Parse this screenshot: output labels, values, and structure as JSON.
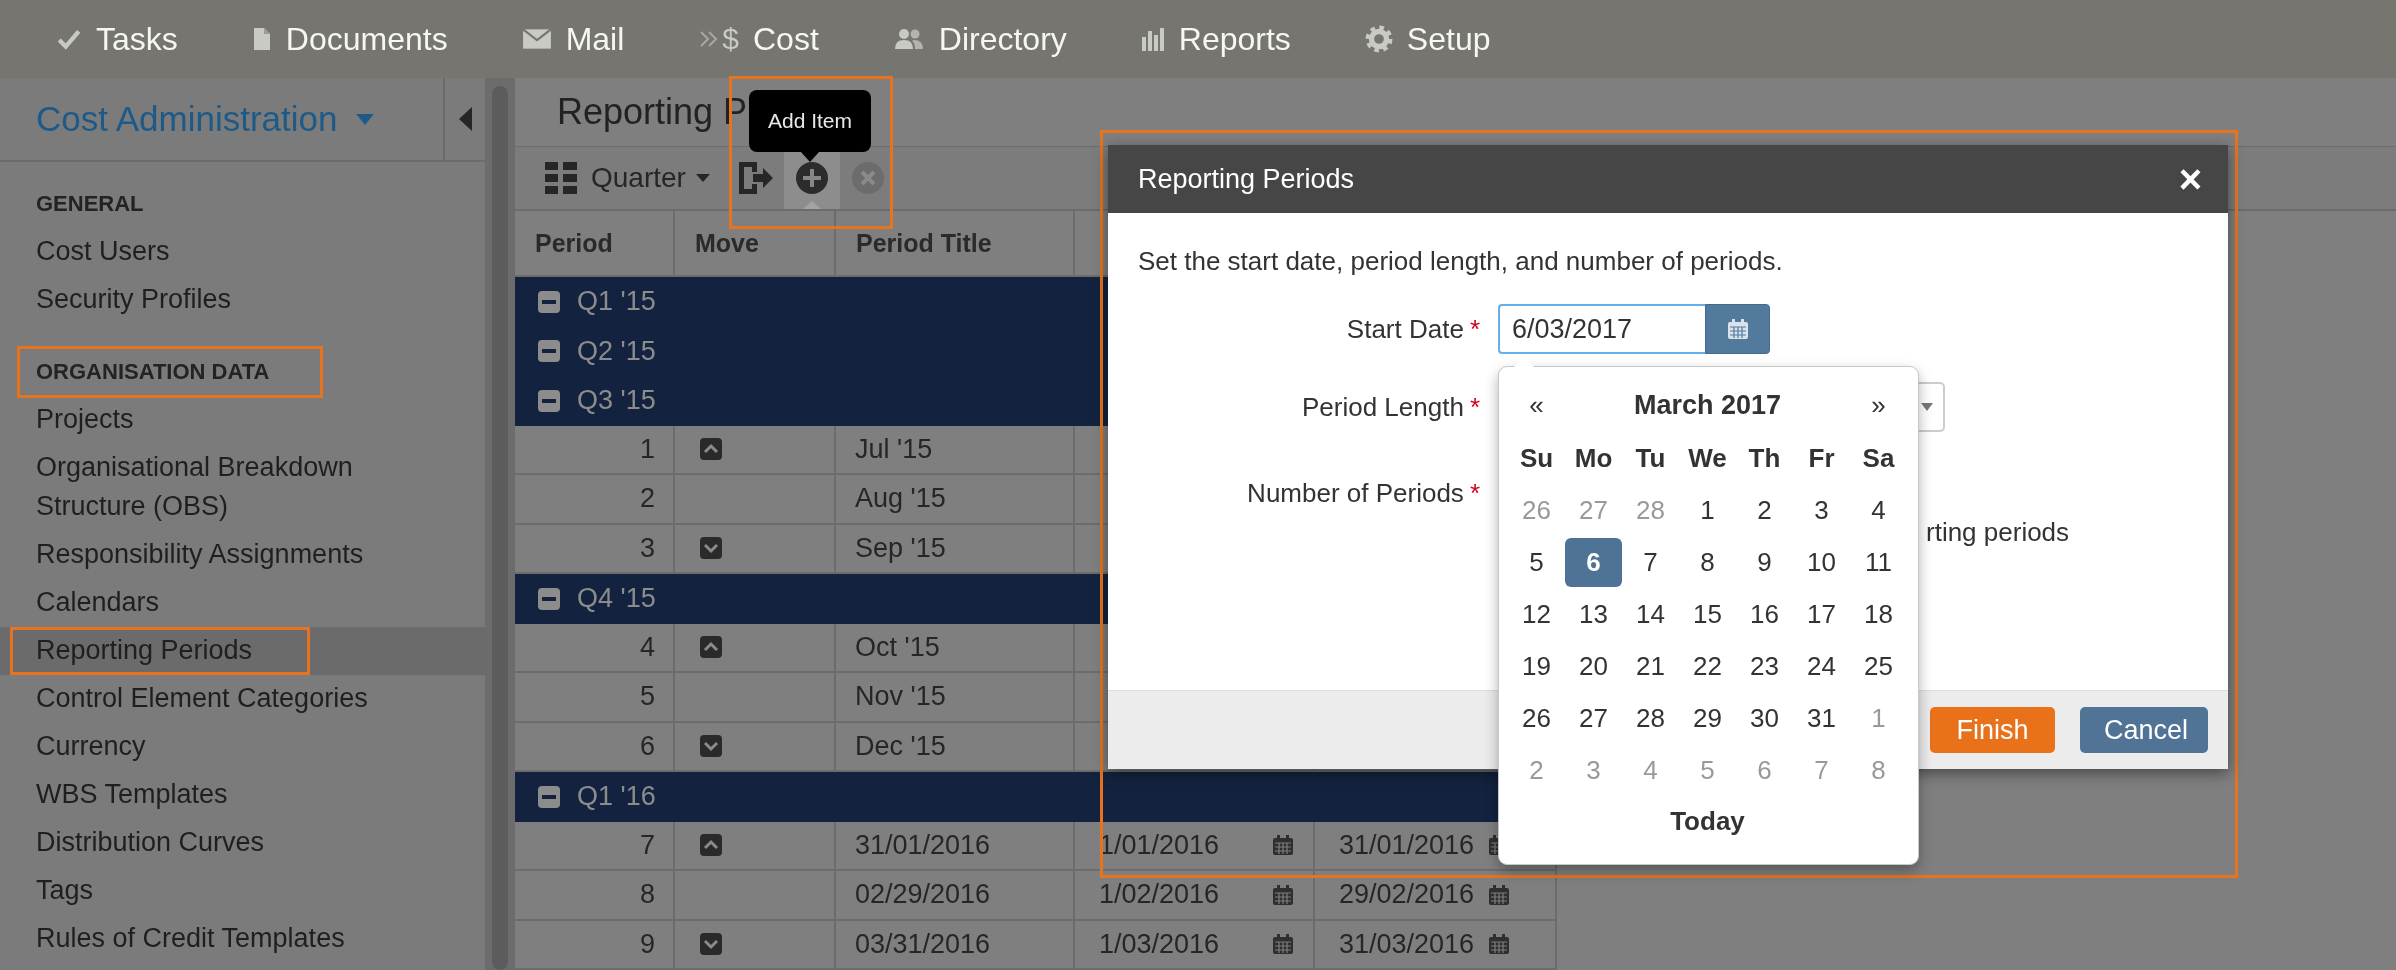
{
  "nav": [
    {
      "kind": "check",
      "label": "Tasks"
    },
    {
      "kind": "document",
      "label": "Documents"
    },
    {
      "kind": "mail",
      "label": "Mail"
    },
    {
      "kind": "cost",
      "icon_text": "$",
      "label": "Cost"
    },
    {
      "kind": "users",
      "label": "Directory"
    },
    {
      "kind": "bars",
      "label": "Reports"
    },
    {
      "kind": "gear",
      "label": "Setup"
    }
  ],
  "sidebar": {
    "title": "Cost Administration",
    "sections": [
      {
        "heading": "GENERAL",
        "framed": false,
        "items": [
          {
            "label": "Cost Users",
            "selected": false,
            "framed": false
          },
          {
            "label": "Security Profiles",
            "selected": false,
            "framed": false
          }
        ]
      },
      {
        "heading": "ORGANISATION DATA",
        "framed": true,
        "items": [
          {
            "label": "Projects",
            "selected": false,
            "framed": false
          },
          {
            "label": "Organisational Breakdown Structure (OBS)",
            "selected": false,
            "framed": false
          },
          {
            "label": "Responsibility Assignments",
            "selected": false,
            "framed": false
          },
          {
            "label": "Calendars",
            "selected": false,
            "framed": false
          },
          {
            "label": "Reporting Periods",
            "selected": true,
            "framed": true
          },
          {
            "label": "Control Element Categories",
            "selected": false,
            "framed": false
          },
          {
            "label": "Currency",
            "selected": false,
            "framed": false
          },
          {
            "label": "WBS Templates",
            "selected": false,
            "framed": false
          },
          {
            "label": "Distribution Curves",
            "selected": false,
            "framed": false
          },
          {
            "label": "Tags",
            "selected": false,
            "framed": false
          },
          {
            "label": "Rules of Credit Templates",
            "selected": false,
            "framed": false
          }
        ]
      }
    ]
  },
  "page_title": "Reporting P",
  "toolbar": {
    "view": "Quarter",
    "framed": true,
    "tooltip": "Add Item",
    "buttons": [
      {
        "kind": "export",
        "hovered": false,
        "disabled": false
      },
      {
        "kind": "add",
        "hovered": true,
        "disabled": false
      },
      {
        "kind": "remove",
        "hovered": false,
        "disabled": true
      }
    ]
  },
  "table": {
    "columns": [
      "Period",
      "Move",
      "Period Title"
    ],
    "rows": [
      {
        "kind": "group",
        "label": "Q1 '15"
      },
      {
        "kind": "group",
        "label": "Q2 '15"
      },
      {
        "kind": "group",
        "label": "Q3 '15"
      },
      {
        "kind": "period",
        "period": "1",
        "can_move_up": true,
        "can_move_down": false,
        "title": "Jul '15"
      },
      {
        "kind": "period",
        "period": "2",
        "can_move_up": false,
        "can_move_down": false,
        "title": "Aug '15"
      },
      {
        "kind": "period",
        "period": "3",
        "can_move_up": false,
        "can_move_down": true,
        "title": "Sep '15"
      },
      {
        "kind": "group",
        "label": "Q4 '15"
      },
      {
        "kind": "period",
        "period": "4",
        "can_move_up": true,
        "can_move_down": false,
        "title": "Oct '15"
      },
      {
        "kind": "period",
        "period": "5",
        "can_move_up": false,
        "can_move_down": false,
        "title": "Nov '15"
      },
      {
        "kind": "period",
        "period": "6",
        "can_move_up": false,
        "can_move_down": true,
        "title": "Dec '15"
      },
      {
        "kind": "group",
        "label": "Q1 '16"
      },
      {
        "kind": "period",
        "period": "7",
        "can_move_up": true,
        "can_move_down": false,
        "title": "31/01/2016",
        "start": "1/01/2016",
        "end": "31/01/2016"
      },
      {
        "kind": "period",
        "period": "8",
        "can_move_up": false,
        "can_move_down": false,
        "title": "02/29/2016",
        "start": "1/02/2016",
        "end": "29/02/2016"
      },
      {
        "kind": "period",
        "period": "9",
        "can_move_up": false,
        "can_move_down": true,
        "title": "03/31/2016",
        "start": "1/03/2016",
        "end": "31/03/2016"
      }
    ]
  },
  "dialog": {
    "title": "Reporting Periods",
    "close": "×",
    "framed": true,
    "intro": "Set the start date, period length, and number of periods.",
    "fields": [
      {
        "label": "Start Date",
        "mark": "*",
        "kind": "date",
        "value": "6/03/2017"
      },
      {
        "label": "Period Length",
        "mark": "*",
        "kind": "select"
      },
      {
        "label": "Number of Periods",
        "mark": "*"
      }
    ],
    "option_text": "rting periods",
    "buttons": [
      {
        "label": "Finish",
        "kind": "primary"
      },
      {
        "label": "Cancel",
        "kind": "secondary"
      }
    ]
  },
  "datepicker": {
    "prev": "«",
    "month": "March 2017",
    "next": "»",
    "weekdays": [
      "Su",
      "Mo",
      "Tu",
      "We",
      "Th",
      "Fr",
      "Sa"
    ],
    "today": "Today",
    "weeks": [
      [
        {
          "day": "26",
          "muted": true,
          "selected": false
        },
        {
          "day": "27",
          "muted": true,
          "selected": false
        },
        {
          "day": "28",
          "muted": true,
          "selected": false
        },
        {
          "day": "1",
          "muted": false,
          "selected": false
        },
        {
          "day": "2",
          "muted": false,
          "selected": false
        },
        {
          "day": "3",
          "muted": false,
          "selected": false
        },
        {
          "day": "4",
          "muted": false,
          "selected": false
        }
      ],
      [
        {
          "day": "5",
          "muted": false,
          "selected": false
        },
        {
          "day": "6",
          "muted": false,
          "selected": true
        },
        {
          "day": "7",
          "muted": false,
          "selected": false
        },
        {
          "day": "8",
          "muted": false,
          "selected": false
        },
        {
          "day": "9",
          "muted": false,
          "selected": false
        },
        {
          "day": "10",
          "muted": false,
          "selected": false
        },
        {
          "day": "11",
          "muted": false,
          "selected": false
        }
      ],
      [
        {
          "day": "12",
          "muted": false,
          "selected": false
        },
        {
          "day": "13",
          "muted": false,
          "selected": false
        },
        {
          "day": "14",
          "muted": false,
          "selected": false
        },
        {
          "day": "15",
          "muted": false,
          "selected": false
        },
        {
          "day": "16",
          "muted": false,
          "selected": false
        },
        {
          "day": "17",
          "muted": false,
          "selected": false
        },
        {
          "day": "18",
          "muted": false,
          "selected": false
        }
      ],
      [
        {
          "day": "19",
          "muted": false,
          "selected": false
        },
        {
          "day": "20",
          "muted": false,
          "selected": false
        },
        {
          "day": "21",
          "muted": false,
          "selected": false
        },
        {
          "day": "22",
          "muted": false,
          "selected": false
        },
        {
          "day": "23",
          "muted": false,
          "selected": false
        },
        {
          "day": "24",
          "muted": false,
          "selected": false
        },
        {
          "day": "25",
          "muted": false,
          "selected": false
        }
      ],
      [
        {
          "day": "26",
          "muted": false,
          "selected": false
        },
        {
          "day": "27",
          "muted": false,
          "selected": false
        },
        {
          "day": "28",
          "muted": false,
          "selected": false
        },
        {
          "day": "29",
          "muted": false,
          "selected": false
        },
        {
          "day": "30",
          "muted": false,
          "selected": false
        },
        {
          "day": "31",
          "muted": false,
          "selected": false
        },
        {
          "day": "1",
          "muted": true,
          "selected": false
        }
      ],
      [
        {
          "day": "2",
          "muted": true,
          "selected": false
        },
        {
          "day": "3",
          "muted": true,
          "selected": false
        },
        {
          "day": "4",
          "muted": true,
          "selected": false
        },
        {
          "day": "5",
          "muted": true,
          "selected": false
        },
        {
          "day": "6",
          "muted": true,
          "selected": false
        },
        {
          "day": "7",
          "muted": true,
          "selected": false
        },
        {
          "day": "8",
          "muted": true,
          "selected": false
        }
      ]
    ]
  }
}
